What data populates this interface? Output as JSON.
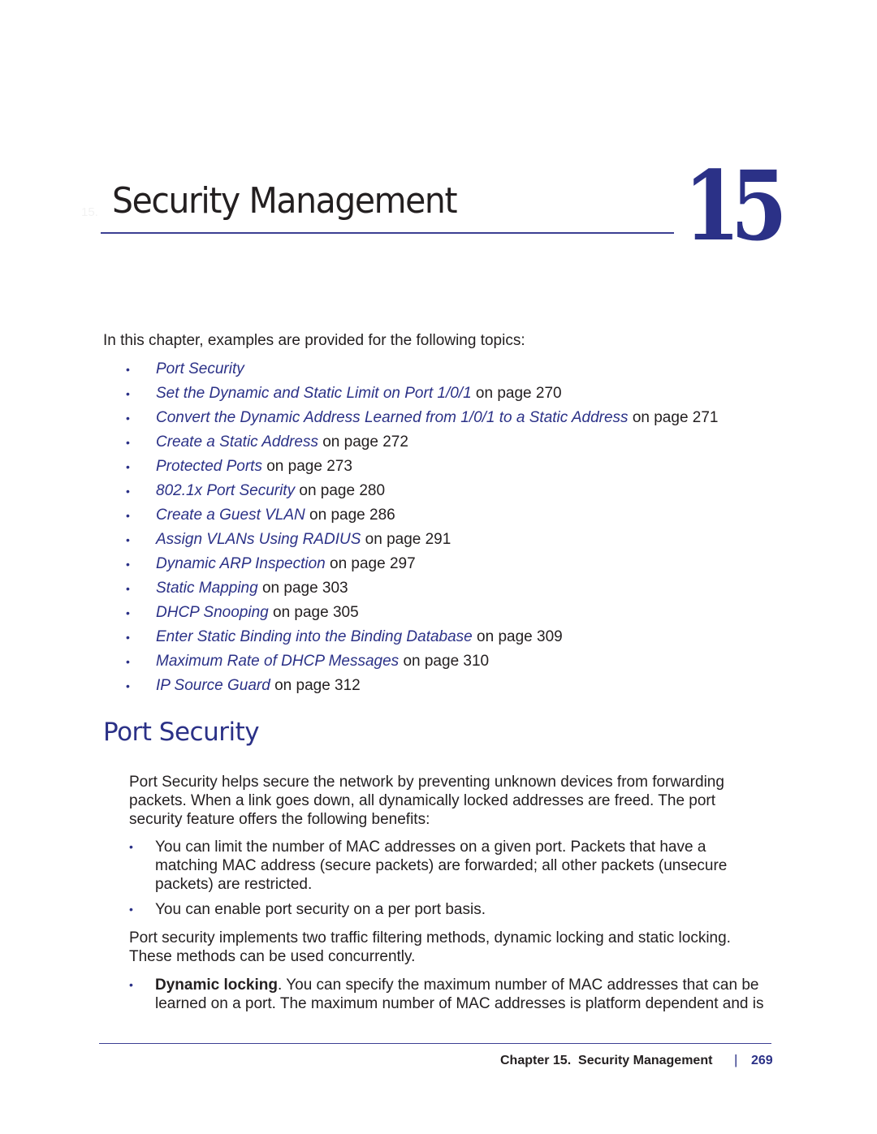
{
  "chapter": {
    "prefix": "15.",
    "title": "Security Management",
    "number": "15"
  },
  "intro": "In this chapter, examples are provided for the following topics:",
  "topics": [
    {
      "link": "Port Security",
      "suffix": ""
    },
    {
      "link": "Set the Dynamic and Static Limit on Port 1/0/1",
      "suffix": " on page 270"
    },
    {
      "link": "Convert the Dynamic Address Learned from 1/0/1 to a Static Address",
      "suffix": " on page 271"
    },
    {
      "link": "Create a Static Address",
      "suffix": " on page 272"
    },
    {
      "link": "Protected Ports",
      "suffix": " on page 273"
    },
    {
      "link": "802.1x Port Security",
      "suffix": " on page 280"
    },
    {
      "link": "Create a Guest VLAN",
      "suffix": " on page 286"
    },
    {
      "link": "Assign VLANs Using RADIUS",
      "suffix": " on page 291"
    },
    {
      "link": "Dynamic ARP Inspection",
      "suffix": " on page 297"
    },
    {
      "link": "Static Mapping",
      "suffix": " on page 303"
    },
    {
      "link": "DHCP Snooping",
      "suffix": " on page 305"
    },
    {
      "link": "Enter Static Binding into the Binding Database",
      "suffix": " on page 309"
    },
    {
      "link": "Maximum Rate of DHCP Messages",
      "suffix": " on page 310"
    },
    {
      "link": "IP Source Guard",
      "suffix": " on page 312"
    }
  ],
  "bullet_glyph": "•",
  "section": {
    "title": "Port Security",
    "paragraph1": "Port Security helps secure the network by preventing unknown devices from forwarding packets. When a link goes down, all dynamically locked addresses are freed. The port security feature offers the following benefits:",
    "benefits": [
      "You can limit the number of MAC addresses on a given port. Packets that have a matching MAC address (secure packets) are forwarded; all other packets (unsecure packets) are restricted.",
      "You can enable port security on a per port basis."
    ],
    "paragraph2": "Port security implements two traffic filtering methods, dynamic locking and static locking. These methods can be used concurrently.",
    "locking": {
      "term": "Dynamic locking",
      "text": ". You can specify the maximum number of MAC addresses that can be learned on a port. The maximum number of MAC addresses is platform dependent and is"
    }
  },
  "footer": {
    "chapter_label": "Chapter 15.  Security Management",
    "separator": "|",
    "page": "269"
  },
  "colors": {
    "accent": "#2b3187",
    "text": "#231f20"
  }
}
